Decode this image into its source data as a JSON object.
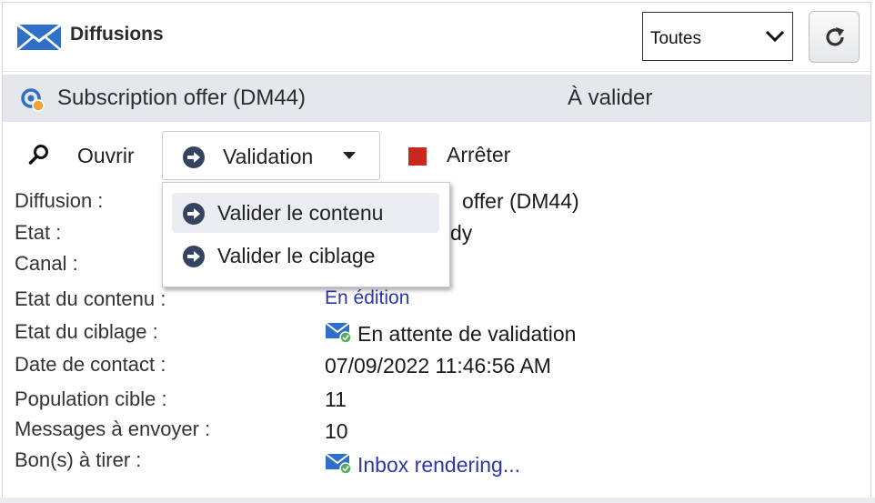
{
  "header": {
    "title": "Diffusions",
    "filter_value": "Toutes"
  },
  "delivery": {
    "name": "Subscription offer (DM44)",
    "status": "À valider"
  },
  "toolbar": {
    "open_label": "Ouvrir",
    "validation_label": "Validation",
    "stop_label": "Arrêter"
  },
  "dropdown": {
    "items": [
      {
        "label": "Valider le contenu"
      },
      {
        "label": "Valider le ciblage"
      }
    ]
  },
  "details": {
    "labels": {
      "delivery": "Diffusion :",
      "state": "Etat :",
      "channel": "Canal :",
      "content_state": "Etat du contenu :",
      "targeting_state": "Etat du ciblage :",
      "contact_date": "Date de contact :",
      "target_population": "Population cible :",
      "messages_to_send": "Messages à envoyer :",
      "proofs": "Bon(s) à tirer :"
    },
    "values": {
      "delivery_partial": "offer (DM44)",
      "state_partial": "dy",
      "content_state": "En édition",
      "targeting_state": "En attente de validation",
      "contact_date": "07/09/2022  11:46:56 AM",
      "target_population": "11",
      "messages_to_send": "10",
      "proofs": "Inbox rendering..."
    }
  },
  "colors": {
    "brand_blue": "#2f6fc9",
    "stop_red": "#c8281e",
    "link_blue": "#2a38a8",
    "arrow_icon": "#34435f"
  }
}
